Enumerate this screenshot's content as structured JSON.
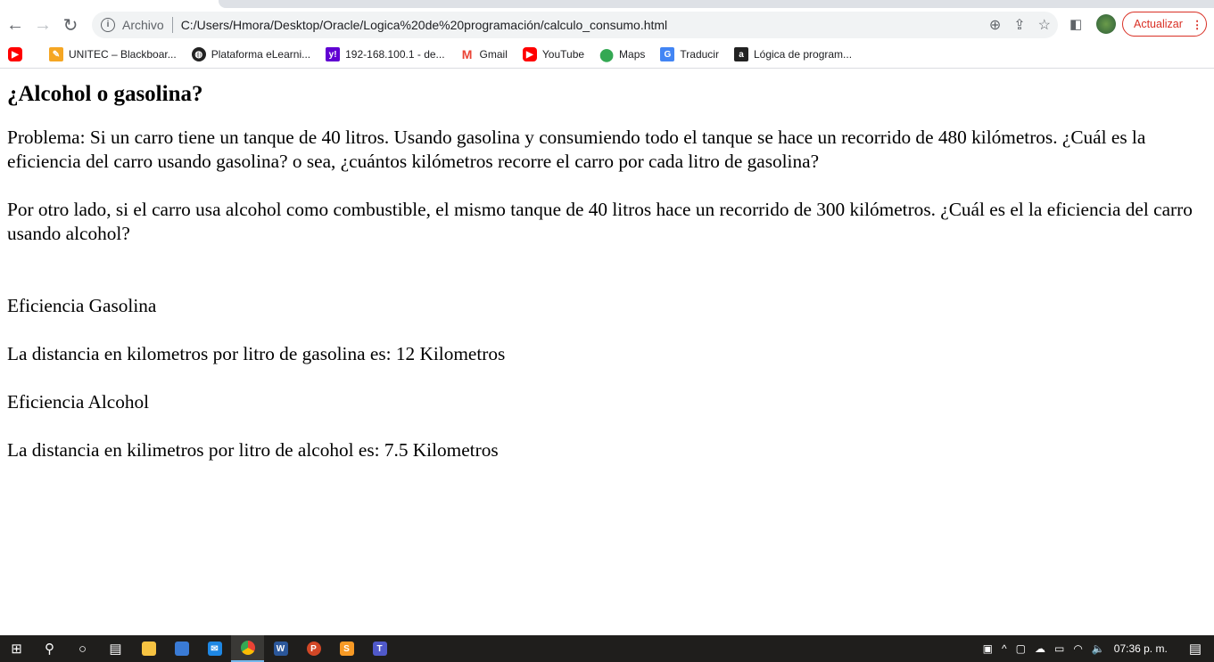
{
  "browser": {
    "address": {
      "security_label": "Archivo",
      "url": "C:/Users/Hmora/Desktop/Oracle/Logica%20de%20programación/calculo_consumo.html"
    },
    "update_label": "Actualizar",
    "bookmarks": [
      {
        "label": "",
        "icon": "youtube-icon",
        "color": "#ff0000"
      },
      {
        "label": "UNITEC – Blackboar...",
        "icon": "pencil-icon",
        "color": "#f5a623"
      },
      {
        "label": "Plataforma eLearni...",
        "icon": "globe-icon",
        "color": "#222222"
      },
      {
        "label": "192-168.100.1 - de...",
        "icon": "yahoo-icon",
        "color": "#6001d2"
      },
      {
        "label": "Gmail",
        "icon": "gmail-icon",
        "color": "#ea4335"
      },
      {
        "label": "YouTube",
        "icon": "youtube-icon",
        "color": "#ff0000"
      },
      {
        "label": "Maps",
        "icon": "maps-icon",
        "color": "#34a853"
      },
      {
        "label": "Traducir",
        "icon": "translate-icon",
        "color": "#4285f4"
      },
      {
        "label": "Lógica de program...",
        "icon": "academia-icon",
        "color": "#222222"
      }
    ]
  },
  "page": {
    "title": "¿Alcohol o gasolina?",
    "paragraph1": "Problema: Si un carro tiene un tanque de 40 litros. Usando gasolina y consumiendo todo el tanque se hace un recorrido de 480 kilómetros. ¿Cuál es la eficiencia del carro usando gasolina? o sea, ¿cuántos kilómetros recorre el carro por cada litro de gasolina?",
    "paragraph2": "Por otro lado, si el carro usa alcohol como combustible, el mismo tanque de 40 litros hace un recorrido de 300 kilómetros. ¿Cuál es el la eficiencia del carro usando alcohol?",
    "gas_heading": "Eficiencia Gasolina",
    "gas_result": "La distancia en kilometros por litro de gasolina es: 12 Kilometros",
    "alcohol_heading": "Eficiencia Alcohol",
    "alcohol_result": "La distancia en kilimetros por litro de alcohol es: 7.5 Kilometros"
  },
  "taskbar": {
    "time": "07:36 p. m."
  }
}
